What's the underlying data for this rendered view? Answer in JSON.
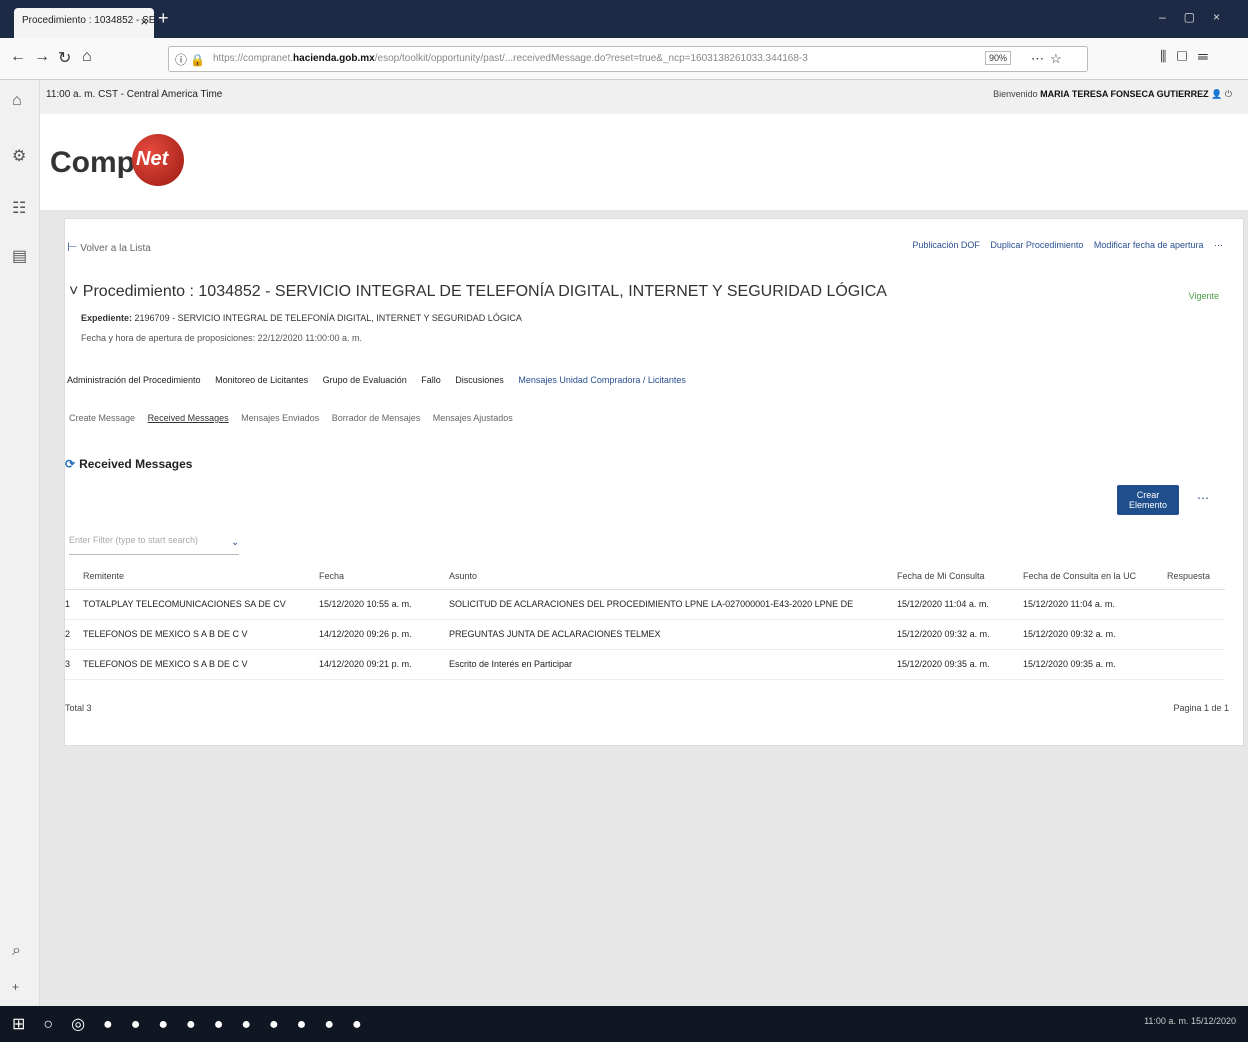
{
  "browser": {
    "tab_title": "Procedimiento : 1034852 - SEF",
    "url_prefix": "https://compranet.",
    "url_domain": "hacienda.gob.mx",
    "url_path": "/esop/toolkit/opportunity/past/...receivedMessage.do?reset=true&_ncp=1603138261033.344168-3",
    "zoom": "90%"
  },
  "header": {
    "time": "11:00 a. m. CST - Central America Time",
    "welcome_label": "Bienvenido",
    "user_name": "MARIA TERESA FONSECA GUTIERREZ"
  },
  "logo": {
    "compra": "Compra",
    "net": "Net"
  },
  "page": {
    "back_link": "Volver a la Lista",
    "actions": [
      "Publicación DOF",
      "Duplicar Procedimiento",
      "Modificar fecha de apertura"
    ],
    "proc_title": "Procedimiento : 1034852 - SERVICIO INTEGRAL DE TELEFONÍA DIGITAL, INTERNET Y SEGURIDAD LÓGICA",
    "status": "Vigente",
    "expediente_label": "Expediente:",
    "expediente_value": "2196709 - SERVICIO INTEGRAL DE TELEFONÍA DIGITAL, INTERNET Y SEGURIDAD LÓGICA",
    "fecha_apertura": "Fecha y hora de apertura de proposiciones: 22/12/2020 11:00:00 a. m.",
    "main_tabs": [
      "Administración del Procedimiento",
      "Monitoreo de Licitantes",
      "Grupo de Evaluación",
      "Fallo",
      "Discusiones",
      "Mensajes Unidad Compradora / Licitantes"
    ],
    "sub_tabs": [
      "Create Message",
      "Received Messages",
      "Mensajes Enviados",
      "Borrador de Mensajes",
      "Mensajes Ajustados"
    ],
    "section_title": "Received Messages",
    "create_button": "Crear Elemento",
    "filter_placeholder": "Enter Filter (type to start search)",
    "table": {
      "headers": [
        "Remitente",
        "Fecha",
        "Asunto",
        "Fecha de Mi Consulta",
        "Fecha de Consulta en la UC",
        "Respuesta"
      ],
      "rows": [
        {
          "num": "1",
          "remitente": "TOTALPLAY TELECOMUNICACIONES SA DE CV",
          "fecha": "15/12/2020 10:55 a. m.",
          "asunto": "SOLICITUD DE ACLARACIONES DEL PROCEDIMIENTO LPNE LA-027000001-E43-2020 LPNE DE",
          "mi_consulta": "15/12/2020 11:04 a. m.",
          "consulta_uc": "15/12/2020 11:04 a. m."
        },
        {
          "num": "2",
          "remitente": "TELEFONOS DE MEXICO S A B DE C V",
          "fecha": "14/12/2020 09:26 p. m.",
          "asunto": "PREGUNTAS JUNTA DE ACLARACIONES TELMEX",
          "mi_consulta": "15/12/2020 09:32 a. m.",
          "consulta_uc": "15/12/2020 09:32 a. m."
        },
        {
          "num": "3",
          "remitente": "TELEFONOS DE MEXICO S A B DE C V",
          "fecha": "14/12/2020 09:21 p. m.",
          "asunto": "Escrito de Interés en Participar",
          "mi_consulta": "15/12/2020 09:35 a. m.",
          "consulta_uc": "15/12/2020 09:35 a. m."
        }
      ]
    },
    "total": "Total 3",
    "pager": "Pagina 1 de 1"
  },
  "taskbar": {
    "clock_time": "11:00 a. m.",
    "clock_date": "15/12/2020"
  }
}
